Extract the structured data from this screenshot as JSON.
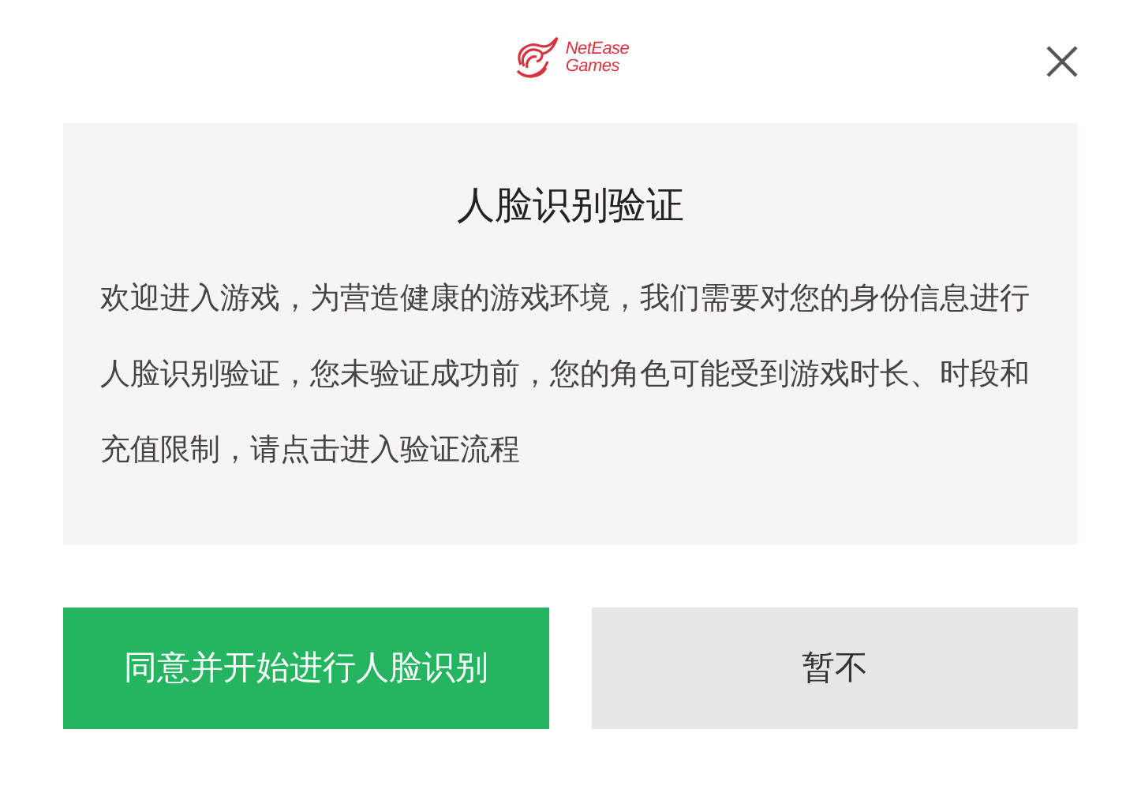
{
  "logo": {
    "line_1": "NetEase",
    "line_2": "Games"
  },
  "dialog": {
    "title": "人脸识别验证",
    "message": "欢迎进入游戏，为营造健康的游戏环境，我们需要对您的身份信息进行人脸识别验证，您未验证成功前，您的角色可能受到游戏时长、时段和充值限制，请点击进入验证流程"
  },
  "buttons": [
    {
      "label": "同意并开始进行人脸识别",
      "kind": "primary"
    },
    {
      "label": "暂不",
      "kind": "secondary"
    }
  ]
}
